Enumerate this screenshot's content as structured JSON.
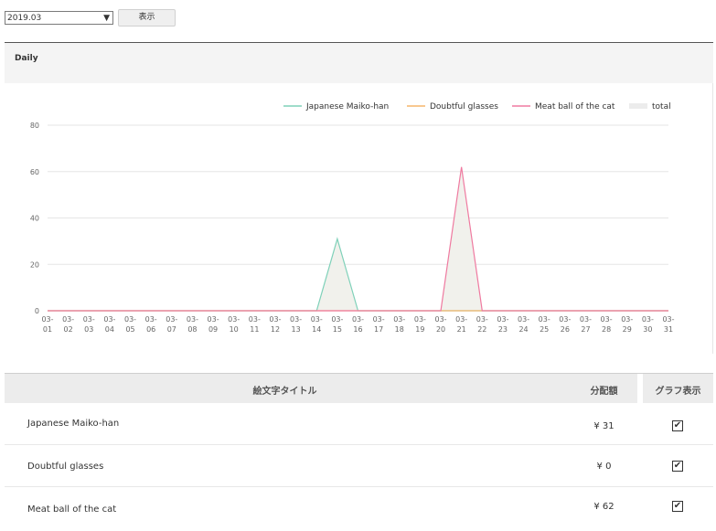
{
  "controls": {
    "month_value": "2019.03",
    "show_label": "表示"
  },
  "panel": {
    "title": "Daily"
  },
  "chart_data": {
    "type": "area",
    "x": [
      "03-01",
      "03-02",
      "03-03",
      "03-04",
      "03-05",
      "03-06",
      "03-07",
      "03-08",
      "03-09",
      "03-10",
      "03-11",
      "03-12",
      "03-13",
      "03-14",
      "03-15",
      "03-16",
      "03-17",
      "03-18",
      "03-19",
      "03-20",
      "03-21",
      "03-22",
      "03-23",
      "03-24",
      "03-25",
      "03-26",
      "03-27",
      "03-28",
      "03-29",
      "03-30",
      "03-31"
    ],
    "ylim": [
      0,
      80
    ],
    "yticks": [
      0,
      20,
      40,
      60,
      80
    ],
    "legend_position": "top-right",
    "grid": true,
    "series": [
      {
        "name": "Japanese Maiko-han",
        "color": "#7fd1b9",
        "values": [
          0,
          0,
          0,
          0,
          0,
          0,
          0,
          0,
          0,
          0,
          0,
          0,
          0,
          0,
          31,
          0,
          0,
          0,
          0,
          0,
          0,
          0,
          0,
          0,
          0,
          0,
          0,
          0,
          0,
          0,
          0
        ]
      },
      {
        "name": "Doubtful glasses",
        "color": "#f5b56b",
        "values": [
          0,
          0,
          0,
          0,
          0,
          0,
          0,
          0,
          0,
          0,
          0,
          0,
          0,
          0,
          0,
          0,
          0,
          0,
          0,
          0,
          0,
          0,
          0,
          0,
          0,
          0,
          0,
          0,
          0,
          0,
          0
        ]
      },
      {
        "name": "Meat ball of the cat",
        "color": "#ef7aa0",
        "values": [
          0,
          0,
          0,
          0,
          0,
          0,
          0,
          0,
          0,
          0,
          0,
          0,
          0,
          0,
          0,
          0,
          0,
          0,
          0,
          0,
          62,
          0,
          0,
          0,
          0,
          0,
          0,
          0,
          0,
          0,
          0
        ]
      },
      {
        "name": "total",
        "color": "#e8e8e8",
        "values": [
          0,
          0,
          0,
          0,
          0,
          0,
          0,
          0,
          0,
          0,
          0,
          0,
          0,
          0,
          31,
          0,
          0,
          0,
          0,
          0,
          62,
          0,
          0,
          0,
          0,
          0,
          0,
          0,
          0,
          0,
          0
        ]
      }
    ]
  },
  "table": {
    "headers": {
      "title": "絵文字タイトル",
      "amount": "分配額",
      "graph": "グラフ表示"
    },
    "rows": [
      {
        "name": "Japanese Maiko-han",
        "amount": "¥ 31",
        "checked": true
      },
      {
        "name": "Doubtful glasses",
        "amount": "¥ 0",
        "checked": true
      },
      {
        "name": "Meat ball of the cat",
        "amount": "¥ 62",
        "checked": true
      }
    ]
  }
}
